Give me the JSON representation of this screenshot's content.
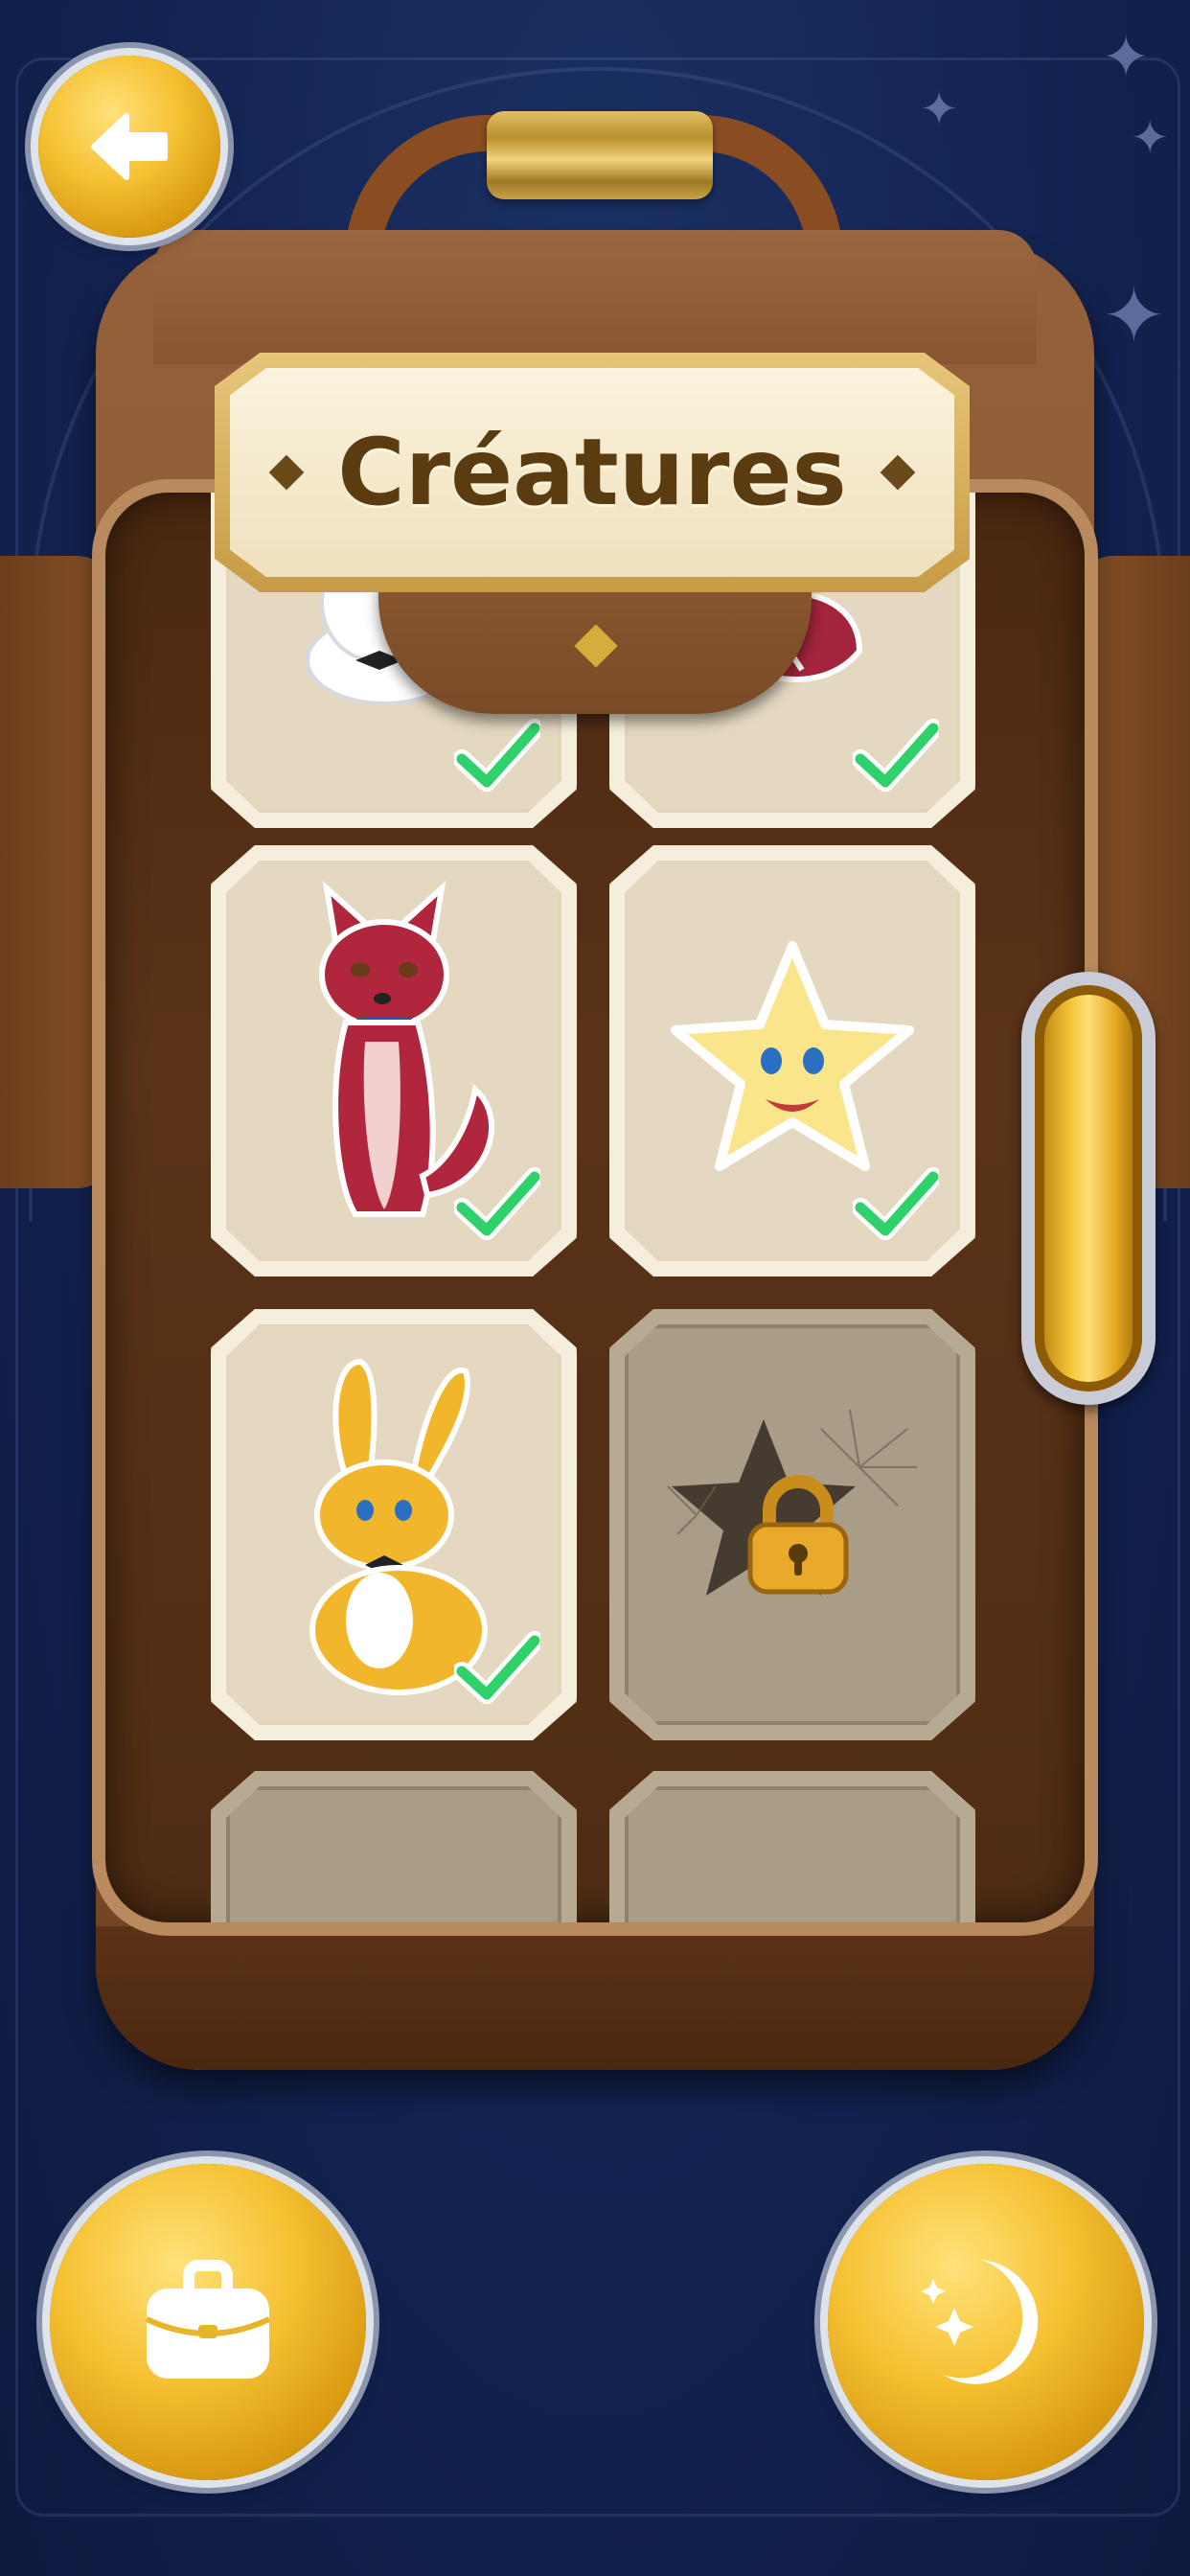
{
  "header": {
    "title": "Créatures",
    "back_icon": "arrow-left-icon"
  },
  "collection": {
    "items": [
      {
        "name": "bunny-white",
        "unlocked": true,
        "checked": true
      },
      {
        "name": "red-creature",
        "unlocked": true,
        "checked": true
      },
      {
        "name": "red-fox",
        "unlocked": true,
        "checked": true
      },
      {
        "name": "yellow-star",
        "unlocked": true,
        "checked": true
      },
      {
        "name": "golden-bunny",
        "unlocked": true,
        "checked": true
      },
      {
        "name": "locked-star",
        "unlocked": false,
        "checked": false
      },
      {
        "name": "hidden-creature-1",
        "unlocked": false,
        "checked": false
      },
      {
        "name": "hidden-creature-2",
        "unlocked": false,
        "checked": false
      }
    ]
  },
  "bottom_bar": {
    "left_icon": "backpack-icon",
    "right_icon": "moon-stars-icon"
  },
  "colors": {
    "background": "#142554",
    "gold": "#f6c234",
    "leather": "#8b5a33",
    "check": "#2fd16a"
  }
}
